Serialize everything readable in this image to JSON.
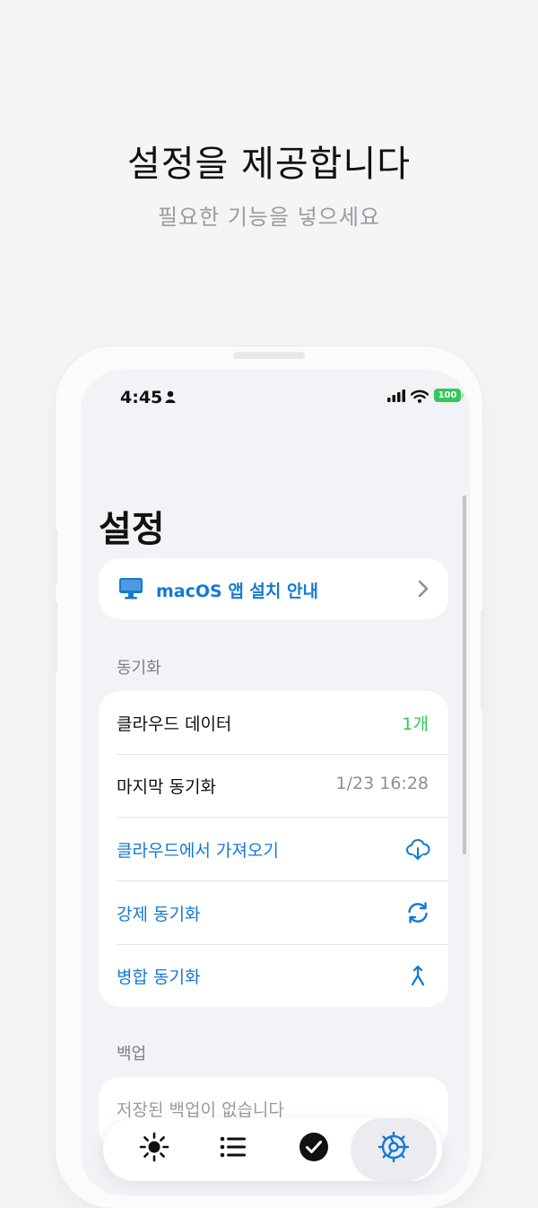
{
  "promo": {
    "headline": "설정을 제공합니다",
    "subline": "필요한 기능을 넣으세요"
  },
  "status_bar": {
    "time": "4:45",
    "battery": "100"
  },
  "settings": {
    "title": "설정",
    "mac_install_label": "macOS 앱 설치 안내",
    "sync_section": "동기화",
    "cloud_data_label": "클라우드 데이터",
    "cloud_data_value": "1개",
    "last_sync_label": "마지막 동기화",
    "last_sync_value": "1/23 16:28",
    "import_cloud_label": "클라우드에서 가져오기",
    "force_sync_label": "강제 동기화",
    "merge_sync_label": "병합 동기화",
    "backup_section": "백업",
    "backup_empty": "저장된 백업이 없습니다"
  },
  "tabs": [
    {
      "icon": "sun-icon",
      "active": false
    },
    {
      "icon": "list-icon",
      "active": false
    },
    {
      "icon": "checkmark-circle-icon",
      "active": false
    },
    {
      "icon": "gear-icon",
      "active": true
    }
  ],
  "colors": {
    "accent_blue": "#1479d3",
    "green": "#34c759",
    "background": "#f2f2f7"
  }
}
